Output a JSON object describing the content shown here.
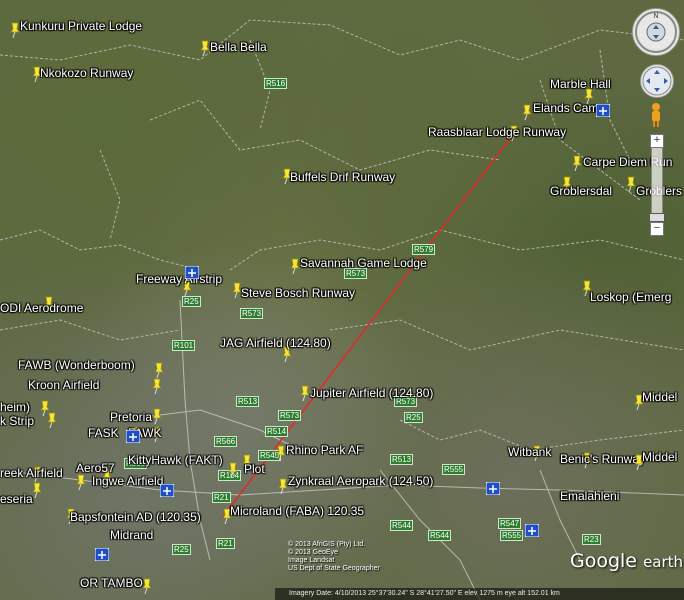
{
  "placemarks": [
    {
      "label": "Kunkuru Private Lodge"
    },
    {
      "label": "Bella Bella"
    },
    {
      "label": "Nkokozo Runway"
    },
    {
      "label": "Marble Hall"
    },
    {
      "label": "Elands Camp"
    },
    {
      "label": "Raasblaar Lodge Runway"
    },
    {
      "label": "Carpe Diem Run"
    },
    {
      "label": "Groblersdal"
    },
    {
      "label": "Groblers"
    },
    {
      "label": "Buffels Drif Runway"
    },
    {
      "label": "Savannah Game Lodge"
    },
    {
      "label": "Freeway Airstrip"
    },
    {
      "label": "Steve Bosch Runway"
    },
    {
      "label": "Loskop (Emerg"
    },
    {
      "label": "ODI Aerodrome"
    },
    {
      "label": "JAG Airfield (124.80)"
    },
    {
      "label": "FAWB (Wonderboom)"
    },
    {
      "label": "Kroon Airfield"
    },
    {
      "label": "Jupiter Airfield (124.80)"
    },
    {
      "label": "Middel"
    },
    {
      "label": "heim)"
    },
    {
      "label": "Pretoria"
    },
    {
      "label": "k Strip"
    },
    {
      "label": "FASK"
    },
    {
      "label": "FAWK"
    },
    {
      "label": "Rhino Park AF"
    },
    {
      "label": "Witbank"
    },
    {
      "label": "Benic's Runway"
    },
    {
      "label": "Middel"
    },
    {
      "label": "reek Airfield"
    },
    {
      "label": "Aero57"
    },
    {
      "label": "KittyHawk (FAKT)"
    },
    {
      "label": "Plot"
    },
    {
      "label": "Ingwe Airfield"
    },
    {
      "label": "Zynkraal Aeropark (124.50)"
    },
    {
      "label": "eseria"
    },
    {
      "label": "Emalahleni"
    },
    {
      "label": "Bapsfontein AD (120.35)"
    },
    {
      "label": "Microland (FABA) 120.35"
    },
    {
      "label": "Midrand"
    },
    {
      "label": "OR TAMBO"
    }
  ],
  "roads": [
    "R516",
    "R573",
    "R25",
    "R573",
    "R579",
    "R101",
    "R513",
    "R573",
    "R573",
    "R25",
    "R566",
    "R514",
    "R104",
    "R513",
    "R555",
    "R21",
    "R547",
    "R544",
    "R544",
    "R555",
    "R21",
    "R23",
    "R25",
    "R545",
    "R555"
  ],
  "attribution": [
    "© 2013 AfriGIS (Pty) Ltd.",
    "© 2013 GeoEye",
    "Image Landsat",
    "US Dept of State Geographer"
  ],
  "statusbar": "Imagery Date: 4/10/2013    25°37'30.24\" S   28°41'27.50\" E   elev 1275 m    eye alt 152.01 km",
  "logo": {
    "google": "Google",
    "earth": "earth"
  },
  "colors": {
    "route": "#e8262b",
    "pin": "#f5e63a",
    "boundary": "#c8c8c8",
    "road_badge": "#2f7d2f"
  }
}
